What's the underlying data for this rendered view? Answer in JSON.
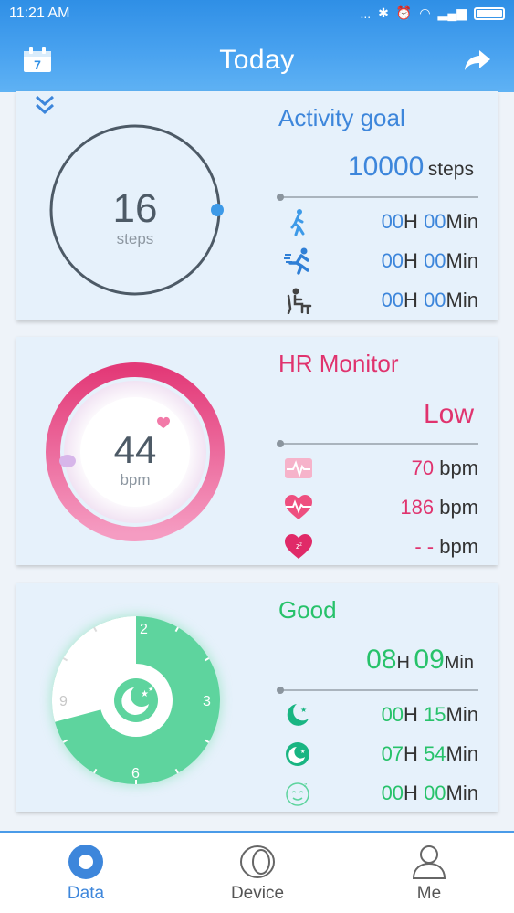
{
  "status_bar": {
    "time": "11:21 AM",
    "dots": "...",
    "icons": [
      "bluetooth-icon",
      "alarm-icon",
      "wifi-icon",
      "signal-icon",
      "battery-icon"
    ]
  },
  "header": {
    "title": "Today",
    "calendar_day": "7"
  },
  "activity": {
    "title": "Activity goal",
    "steps_value": "16",
    "steps_unit": "steps",
    "goal_value": "10000",
    "goal_unit": "steps",
    "rows": [
      {
        "icon": "walk-icon",
        "h": "00",
        "h_unit": "H",
        "m": "00",
        "m_unit": "Min"
      },
      {
        "icon": "run-icon",
        "h": "00",
        "h_unit": "H",
        "m": "00",
        "m_unit": "Min"
      },
      {
        "icon": "sit-icon",
        "h": "00",
        "h_unit": "H",
        "m": "00",
        "m_unit": "Min"
      }
    ]
  },
  "hr": {
    "title": "HR Monitor",
    "status": "Low",
    "value": "44",
    "unit": "bpm",
    "rows": [
      {
        "icon": "ecg-icon",
        "value": "70",
        "unit": "bpm"
      },
      {
        "icon": "heart-pulse-icon",
        "value": "186",
        "unit": "bpm"
      },
      {
        "icon": "heart-sleep-icon",
        "value": "- -",
        "unit": "bpm"
      }
    ]
  },
  "sleep": {
    "title": "Good",
    "total_h": "08",
    "total_h_unit": "H",
    "total_m": "09",
    "total_m_unit": "Min",
    "dial_labels": [
      "2",
      "3",
      "6",
      "9"
    ],
    "rows": [
      {
        "icon": "deep-sleep-icon",
        "h": "00",
        "h_unit": "H",
        "m": "15",
        "m_unit": "Min"
      },
      {
        "icon": "light-sleep-icon",
        "h": "07",
        "h_unit": "H",
        "m": "54",
        "m_unit": "Min"
      },
      {
        "icon": "awake-icon",
        "h": "00",
        "h_unit": "H",
        "m": "00",
        "m_unit": "Min"
      }
    ]
  },
  "nav": {
    "items": [
      {
        "label": "Data",
        "active": true
      },
      {
        "label": "Device",
        "active": false
      },
      {
        "label": "Me",
        "active": false
      }
    ]
  },
  "colors": {
    "accent": "#3d86db",
    "pink": "#e0336e",
    "green": "#27c26a",
    "header": "#4aa3f0"
  }
}
